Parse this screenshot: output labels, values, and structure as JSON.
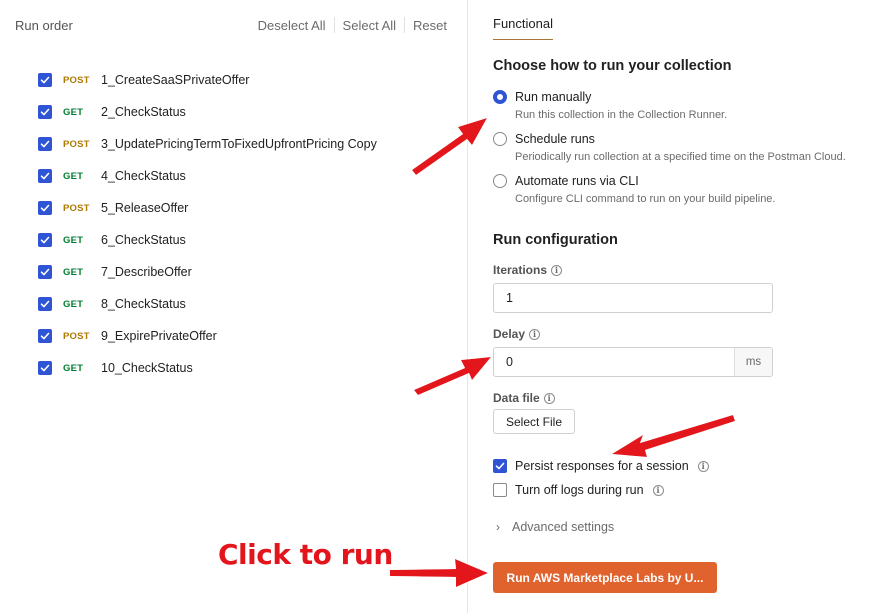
{
  "left": {
    "title": "Run order",
    "actions": [
      "Deselect All",
      "Select All",
      "Reset"
    ],
    "requests": [
      {
        "method": "POST",
        "name": "1_CreateSaaSPrivateOffer"
      },
      {
        "method": "GET",
        "name": "2_CheckStatus"
      },
      {
        "method": "POST",
        "name": "3_UpdatePricingTermToFixedUpfrontPricing Copy"
      },
      {
        "method": "GET",
        "name": "4_CheckStatus"
      },
      {
        "method": "POST",
        "name": "5_ReleaseOffer"
      },
      {
        "method": "GET",
        "name": "6_CheckStatus"
      },
      {
        "method": "GET",
        "name": "7_DescribeOffer"
      },
      {
        "method": "GET",
        "name": "8_CheckStatus"
      },
      {
        "method": "POST",
        "name": "9_ExpirePrivateOffer"
      },
      {
        "method": "GET",
        "name": "10_CheckStatus"
      }
    ]
  },
  "right": {
    "tab": "Functional",
    "run_section_title": "Choose how to run your collection",
    "run_options": [
      {
        "label": "Run manually",
        "desc": "Run this collection in the Collection Runner.",
        "selected": true
      },
      {
        "label": "Schedule runs",
        "desc": "Periodically run collection at a specified time on the Postman Cloud.",
        "selected": false
      },
      {
        "label": "Automate runs via CLI",
        "desc": "Configure CLI command to run on your build pipeline.",
        "selected": false
      }
    ],
    "config_title": "Run configuration",
    "iterations_label": "Iterations",
    "iterations_value": "1",
    "delay_label": "Delay",
    "delay_value": "0",
    "delay_unit": "ms",
    "datafile_label": "Data file",
    "select_file_label": "Select File",
    "persist_label": "Persist responses for a session",
    "persist_checked": true,
    "logs_label": "Turn off logs during run",
    "logs_checked": false,
    "advanced_label": "Advanced settings",
    "run_button_label": "Run AWS Marketplace Labs by U..."
  },
  "annotation": {
    "click_label": "Click to run",
    "arrow_color": "#e3141b"
  },
  "colors": {
    "accent_blue": "#2f55d4",
    "run_button": "#e0622d",
    "post_method": "#ad7a03",
    "get_method": "#007f31"
  }
}
